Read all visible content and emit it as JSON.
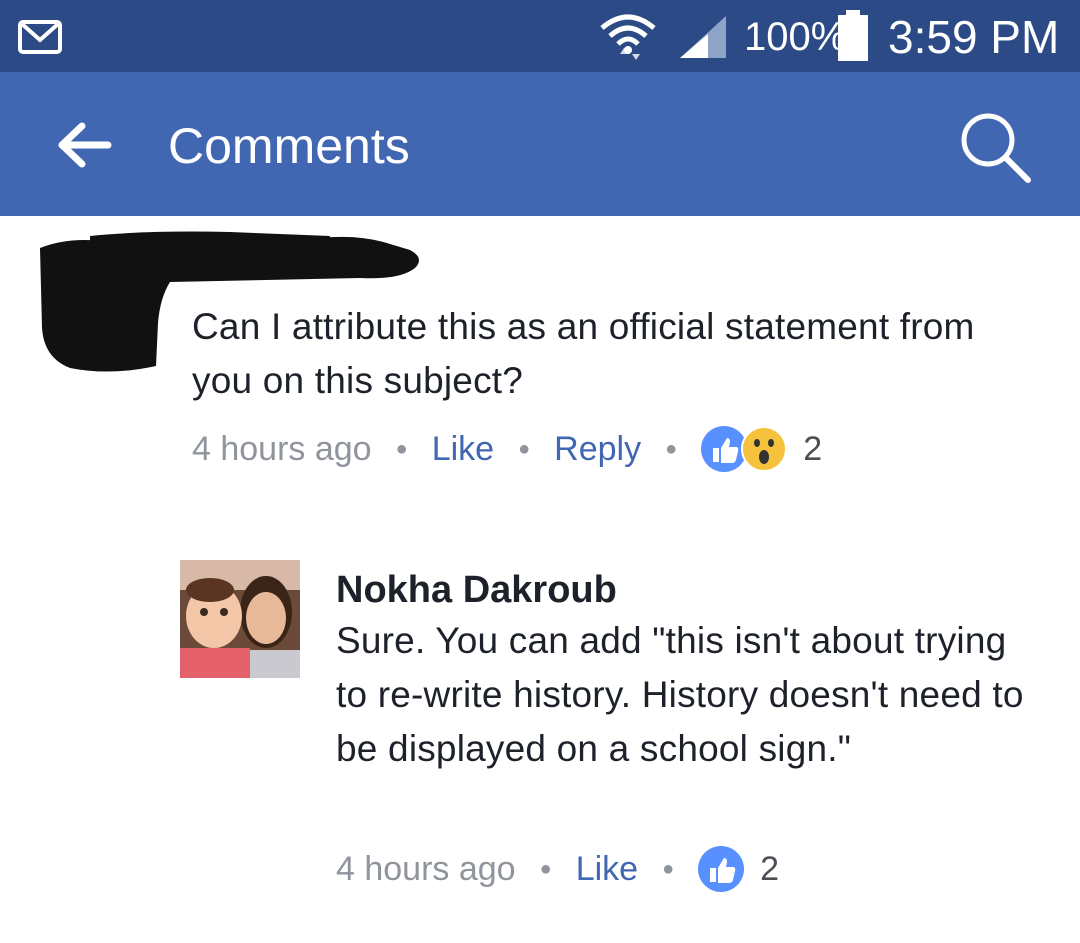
{
  "status_bar": {
    "battery": "100%",
    "time": "3:59 PM",
    "icons": [
      "gmail-icon",
      "wifi-icon",
      "signal-icon",
      "battery-icon"
    ]
  },
  "header": {
    "title": "Comments",
    "back_icon": "back-arrow-icon",
    "search_icon": "search-icon",
    "background": "#4267b2"
  },
  "comments": [
    {
      "author": "",
      "text": "Can I attribute this as an official statement from you on this subject?",
      "time": "4 hours ago",
      "like_label": "Like",
      "reply_label": "Reply",
      "reactions": [
        "like",
        "wow"
      ],
      "reaction_count": "2"
    },
    {
      "author": "Nokha Dakroub",
      "text": "Sure. You can add \"this isn't about trying to re-write history. History doesn't need to be displayed on a school sign.\"",
      "time": "4 hours ago",
      "like_label": "Like",
      "reactions": [
        "like"
      ],
      "reaction_count": "2"
    }
  ],
  "colors": {
    "status_bar": "#2b4a86",
    "link": "#4267b2",
    "muted": "#90949c",
    "like_reaction": "#5890ff",
    "wow_reaction": "#f7c23b"
  }
}
